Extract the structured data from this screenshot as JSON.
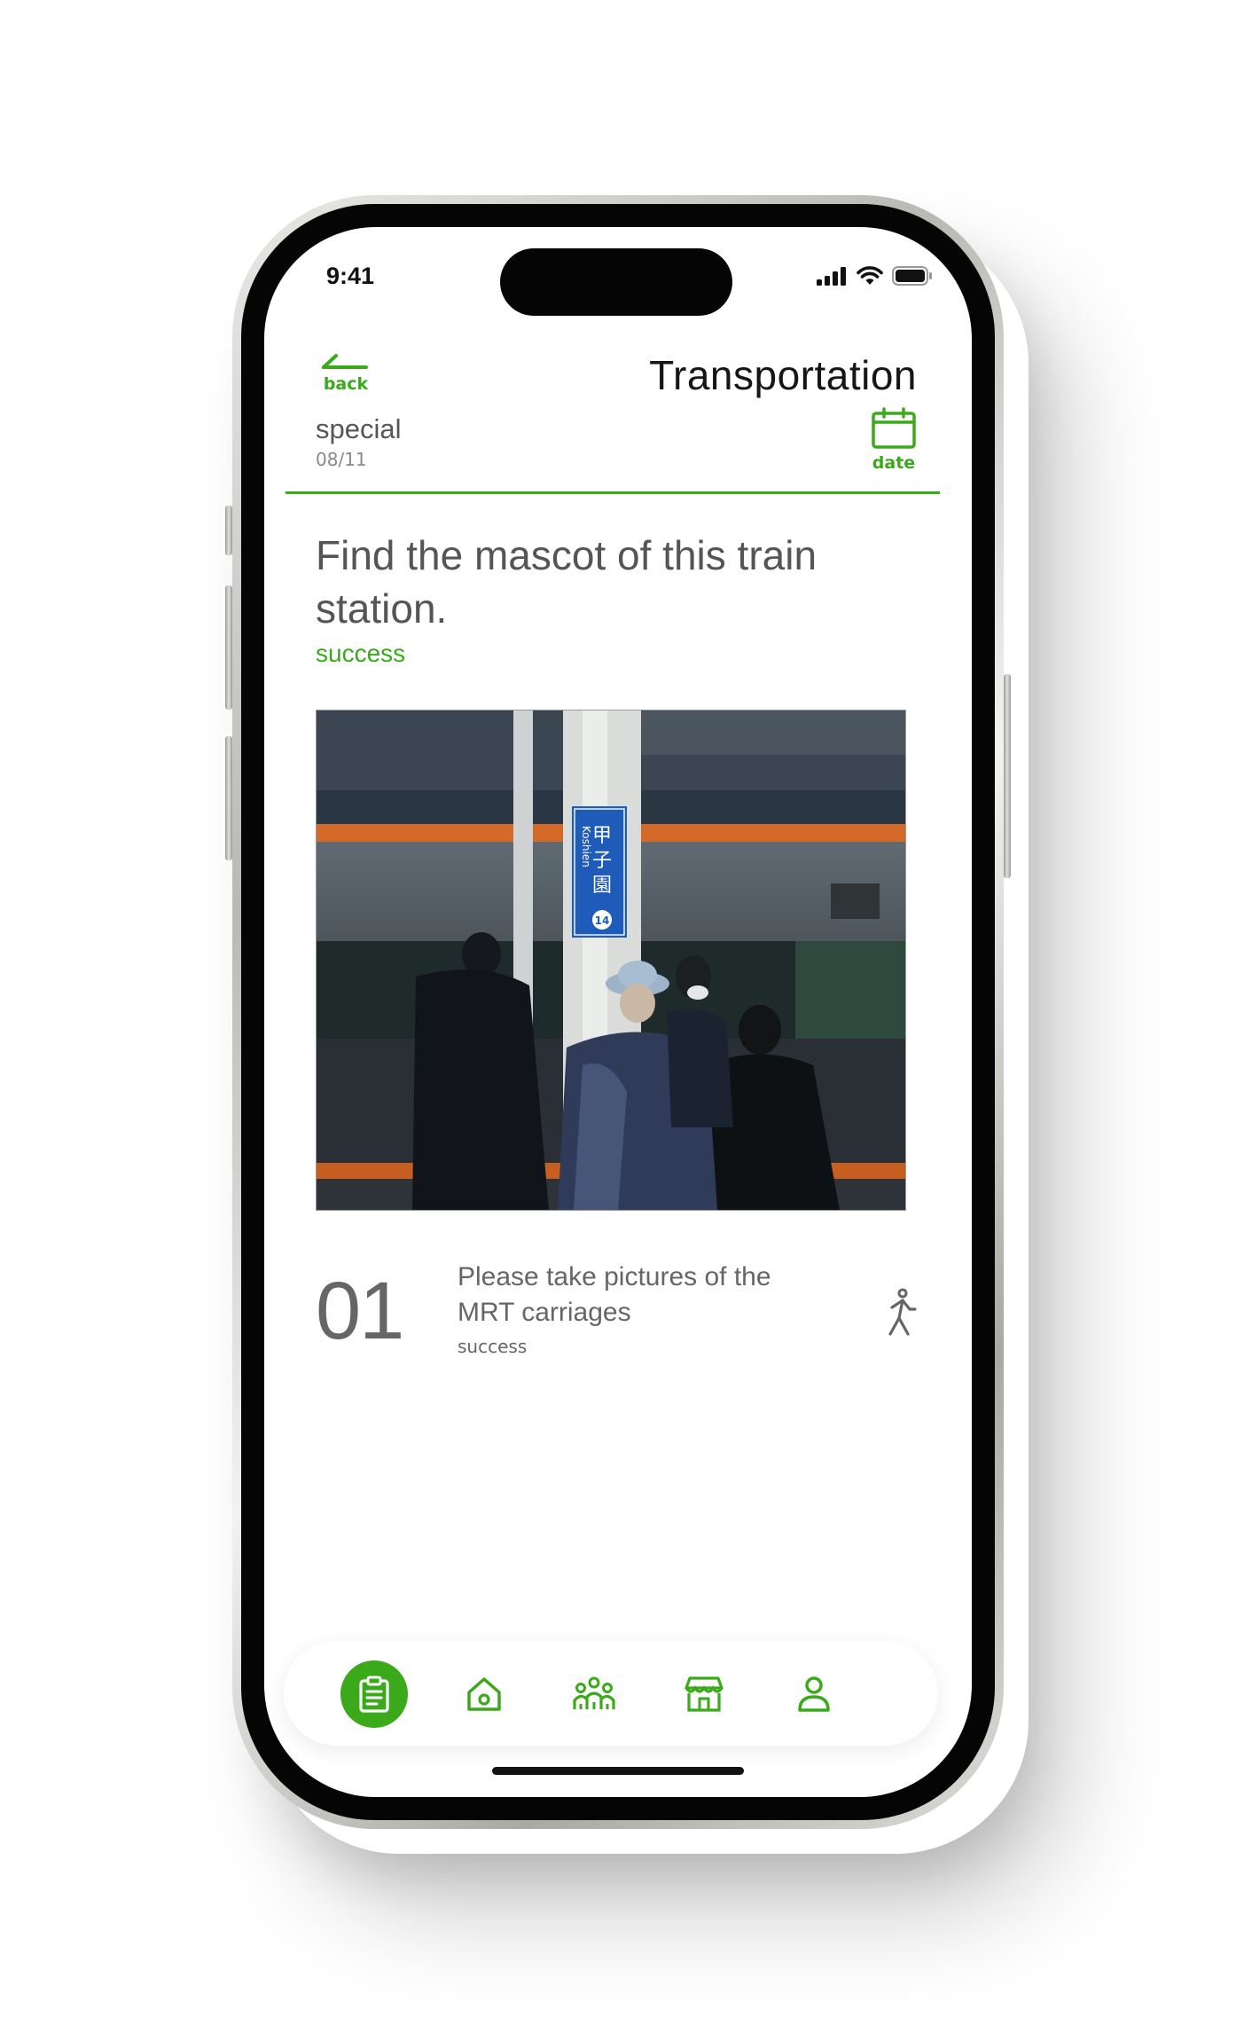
{
  "status_bar": {
    "time": "9:41"
  },
  "header": {
    "back_label": "back",
    "title": "Transportation",
    "category": "special",
    "category_date": "08/11",
    "date_label": "date"
  },
  "task": {
    "title": "Find the mascot of this train station.",
    "status": "success",
    "photo_sign": {
      "kanji": "甲子園",
      "romaji": "Koshien",
      "number": "14"
    }
  },
  "mission": {
    "number": "01",
    "text": "Please take pictures of the MRT carriages",
    "status": "success",
    "icon": "walking-person-icon"
  },
  "bottom_nav": {
    "items": [
      {
        "icon": "clipboard-icon",
        "active": true
      },
      {
        "icon": "home-icon",
        "active": false
      },
      {
        "icon": "group-icon",
        "active": false
      },
      {
        "icon": "store-icon",
        "active": false
      },
      {
        "icon": "person-icon",
        "active": false
      }
    ]
  },
  "colors": {
    "accent": "#3aaa1b",
    "text": "#555555",
    "title": "#161616"
  }
}
